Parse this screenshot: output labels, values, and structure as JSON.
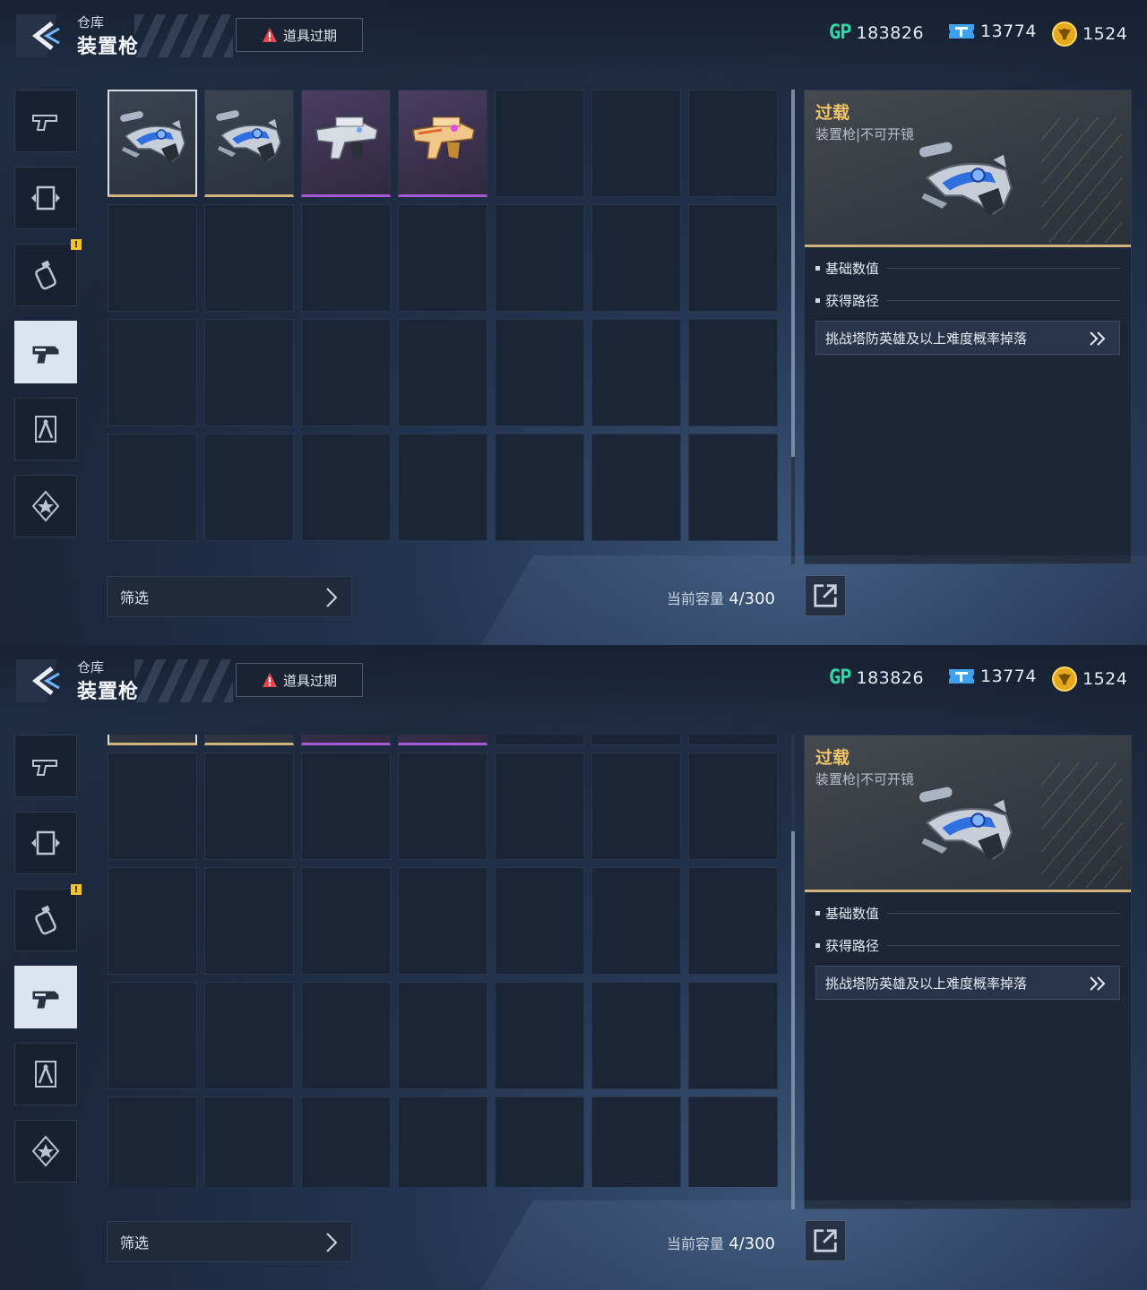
{
  "screens": [
    {
      "header": {
        "breadcrumb": "仓库",
        "title": "装置枪",
        "expired_label": "道具过期"
      },
      "currencies": {
        "gp_icon": "GP",
        "gp": "183826",
        "ticket": "13774",
        "coin": "1524"
      },
      "sidebar": [
        {
          "icon": "pistol-icon",
          "active": false,
          "badge": ""
        },
        {
          "icon": "frame-icon",
          "active": false,
          "badge": ""
        },
        {
          "icon": "grenade-icon",
          "active": false,
          "badge": "!"
        },
        {
          "icon": "device-gun-icon",
          "active": true,
          "badge": ""
        },
        {
          "icon": "compass-icon",
          "active": false,
          "badge": ""
        },
        {
          "icon": "star-badge-icon",
          "active": false,
          "badge": ""
        }
      ],
      "grid": {
        "scroll_state": "top"
      },
      "filter_label": "筛选",
      "capacity": {
        "label": "当前容量",
        "value": "4/300"
      },
      "detail": {
        "name": "过载",
        "subtitle": "装置枪|不可开镜",
        "sections": [
          "基础数值",
          "获得路径"
        ],
        "route": "挑战塔防英雄及以上难度概率掉落"
      }
    },
    {
      "header": {
        "breadcrumb": "仓库",
        "title": "装置枪",
        "expired_label": "道具过期"
      },
      "currencies": {
        "gp_icon": "GP",
        "gp": "183826",
        "ticket": "13774",
        "coin": "1524"
      },
      "sidebar": [
        {
          "icon": "pistol-icon",
          "active": false,
          "badge": ""
        },
        {
          "icon": "frame-icon",
          "active": false,
          "badge": ""
        },
        {
          "icon": "grenade-icon",
          "active": false,
          "badge": "!"
        },
        {
          "icon": "device-gun-icon",
          "active": true,
          "badge": ""
        },
        {
          "icon": "compass-icon",
          "active": false,
          "badge": ""
        },
        {
          "icon": "star-badge-icon",
          "active": false,
          "badge": ""
        }
      ],
      "grid": {
        "scroll_state": "scrolled"
      },
      "filter_label": "筛选",
      "capacity": {
        "label": "当前容量",
        "value": "4/300"
      },
      "detail": {
        "name": "过载",
        "subtitle": "装置枪|不可开镜",
        "sections": [
          "基础数值",
          "获得路径"
        ],
        "route": "挑战塔防英雄及以上难度概率掉落"
      }
    }
  ],
  "inventory_items": [
    {
      "name": "overload-blue-gun",
      "rarity": "gold",
      "selected": true
    },
    {
      "name": "overload-blue-gun",
      "rarity": "gold",
      "selected": false
    },
    {
      "name": "silver-device-gun",
      "rarity": "purple",
      "selected": false
    },
    {
      "name": "gold-device-gun",
      "rarity": "purple",
      "selected": false
    }
  ],
  "total_slots": 35,
  "colors": {
    "gold_rarity": "#d1b47a",
    "purple_rarity": "#a85ad6",
    "item_name": "#f0c46a",
    "gp": "#34d4a6"
  }
}
